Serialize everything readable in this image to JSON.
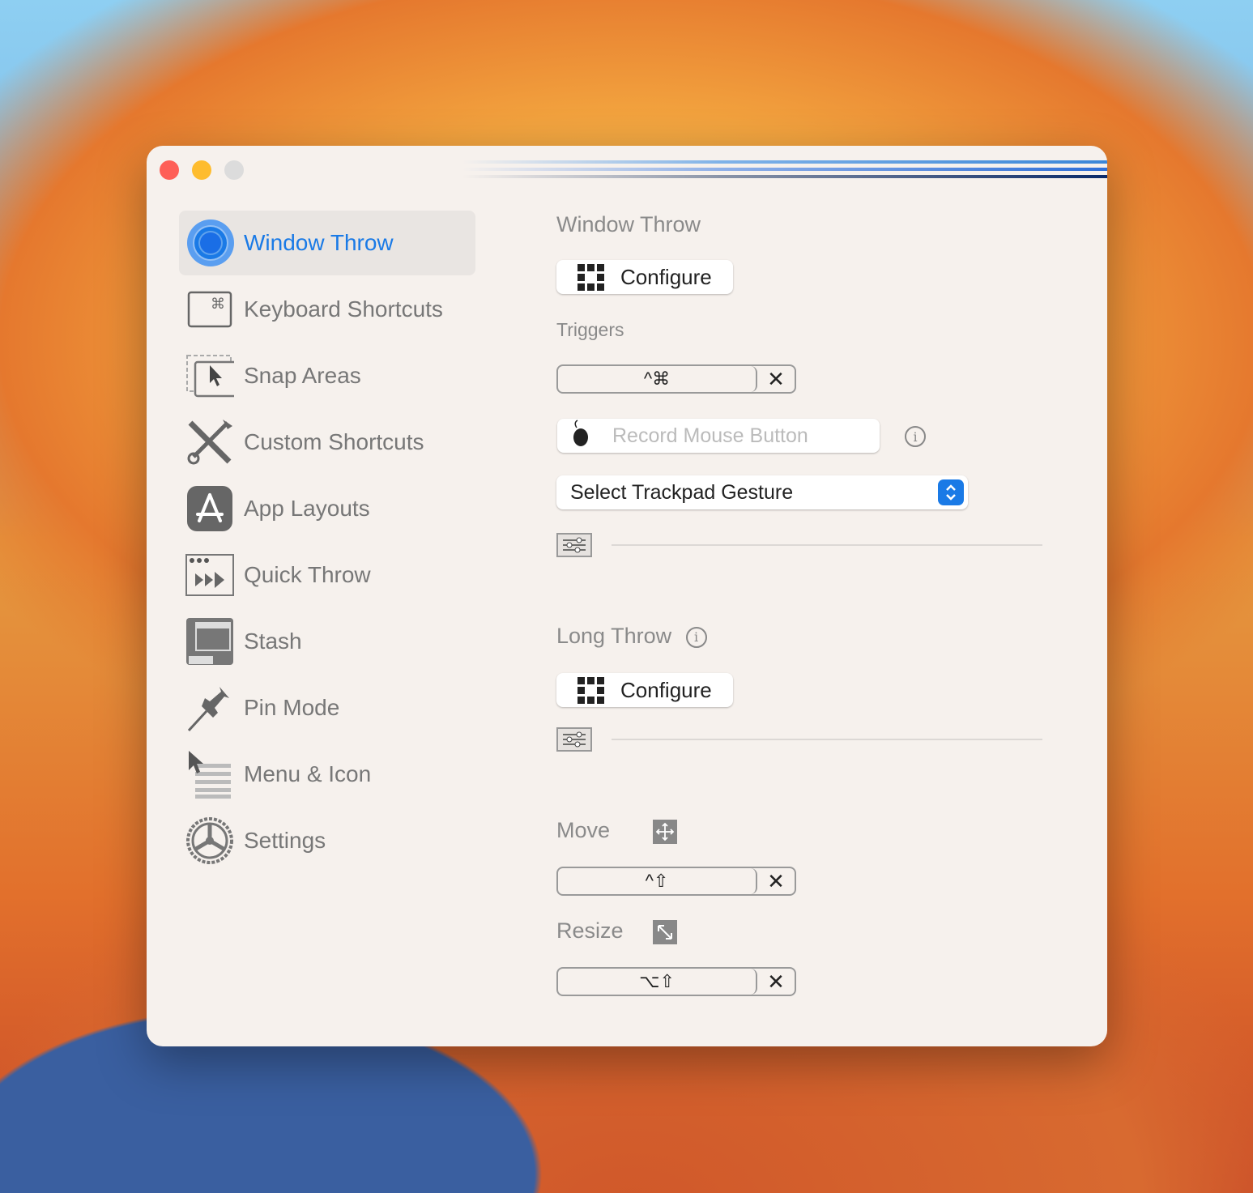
{
  "sidebar": {
    "items": [
      {
        "label": "Window Throw",
        "icon": "target-icon",
        "selected": true
      },
      {
        "label": "Keyboard Shortcuts",
        "icon": "command-key-icon"
      },
      {
        "label": "Snap Areas",
        "icon": "snap-cursor-icon"
      },
      {
        "label": "Custom Shortcuts",
        "icon": "tools-icon"
      },
      {
        "label": "App Layouts",
        "icon": "app-store-icon"
      },
      {
        "label": "Quick Throw",
        "icon": "quick-throw-icon"
      },
      {
        "label": "Stash",
        "icon": "stash-icon"
      },
      {
        "label": "Pin Mode",
        "icon": "pin-icon"
      },
      {
        "label": "Menu & Icon",
        "icon": "menu-cursor-icon"
      },
      {
        "label": "Settings",
        "icon": "gear-icon"
      }
    ]
  },
  "main": {
    "title": "Window Throw",
    "configure_label": "Configure",
    "triggers_label": "Triggers",
    "trigger_shortcut": "^⌘",
    "clear_symbol": "✕",
    "mouse_placeholder": "Record Mouse Button",
    "gesture_select": "Select Trackpad Gesture",
    "info_symbol": "i",
    "long_throw_label": "Long Throw",
    "move_label": "Move",
    "move_shortcut": "^⇧",
    "resize_label": "Resize",
    "resize_shortcut": "⌥⇧"
  },
  "colors": {
    "accent": "#1a7ae6",
    "close": "#fe5f57",
    "minimize": "#febc2e",
    "zoom": "#dcdcdc"
  }
}
